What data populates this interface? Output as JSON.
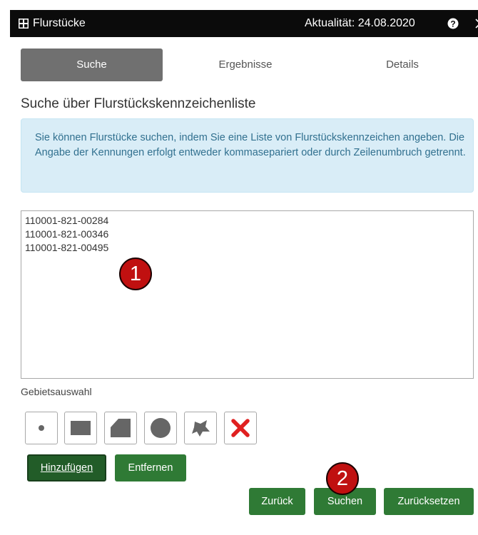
{
  "window": {
    "title": "Flurstücke",
    "aktualitaet": "Aktualität: 24.08.2020"
  },
  "tabs": [
    {
      "label": "Suche",
      "active": true
    },
    {
      "label": "Ergebnisse",
      "active": false
    },
    {
      "label": "Details",
      "active": false
    }
  ],
  "section_heading": "Suche über Flurstückskennzeichenliste",
  "info_text": "Sie können Flurstücke suchen, indem Sie eine Liste von Flurstückskennzeichen angeben. Die Angabe der Kennungen erfolgt entweder kommasepariert oder durch Zeilenumbruch getrennt.",
  "textarea_value": "110001-821-00284\n110001-821-00346\n110001-821-00495",
  "callouts": [
    "1",
    "2"
  ],
  "gebiet": {
    "label": "Gebietsauswahl",
    "tools": [
      "point-icon",
      "rectangle-icon",
      "polygon-icon",
      "circle-icon",
      "freehand-icon",
      "delete-icon"
    ]
  },
  "buttons": {
    "add": "Hinzufügen",
    "remove": "Entfernen",
    "back": "Zurück",
    "search": "Suchen",
    "reset": "Zurücksetzen"
  },
  "colors": {
    "titlebar": "#0b0b0b",
    "tab_active": "#707070",
    "info_bg": "#d9edf7",
    "info_text": "#31708f",
    "button_green": "#2f7a35",
    "callout_red": "#c01010",
    "delete_red": "#e02020"
  }
}
